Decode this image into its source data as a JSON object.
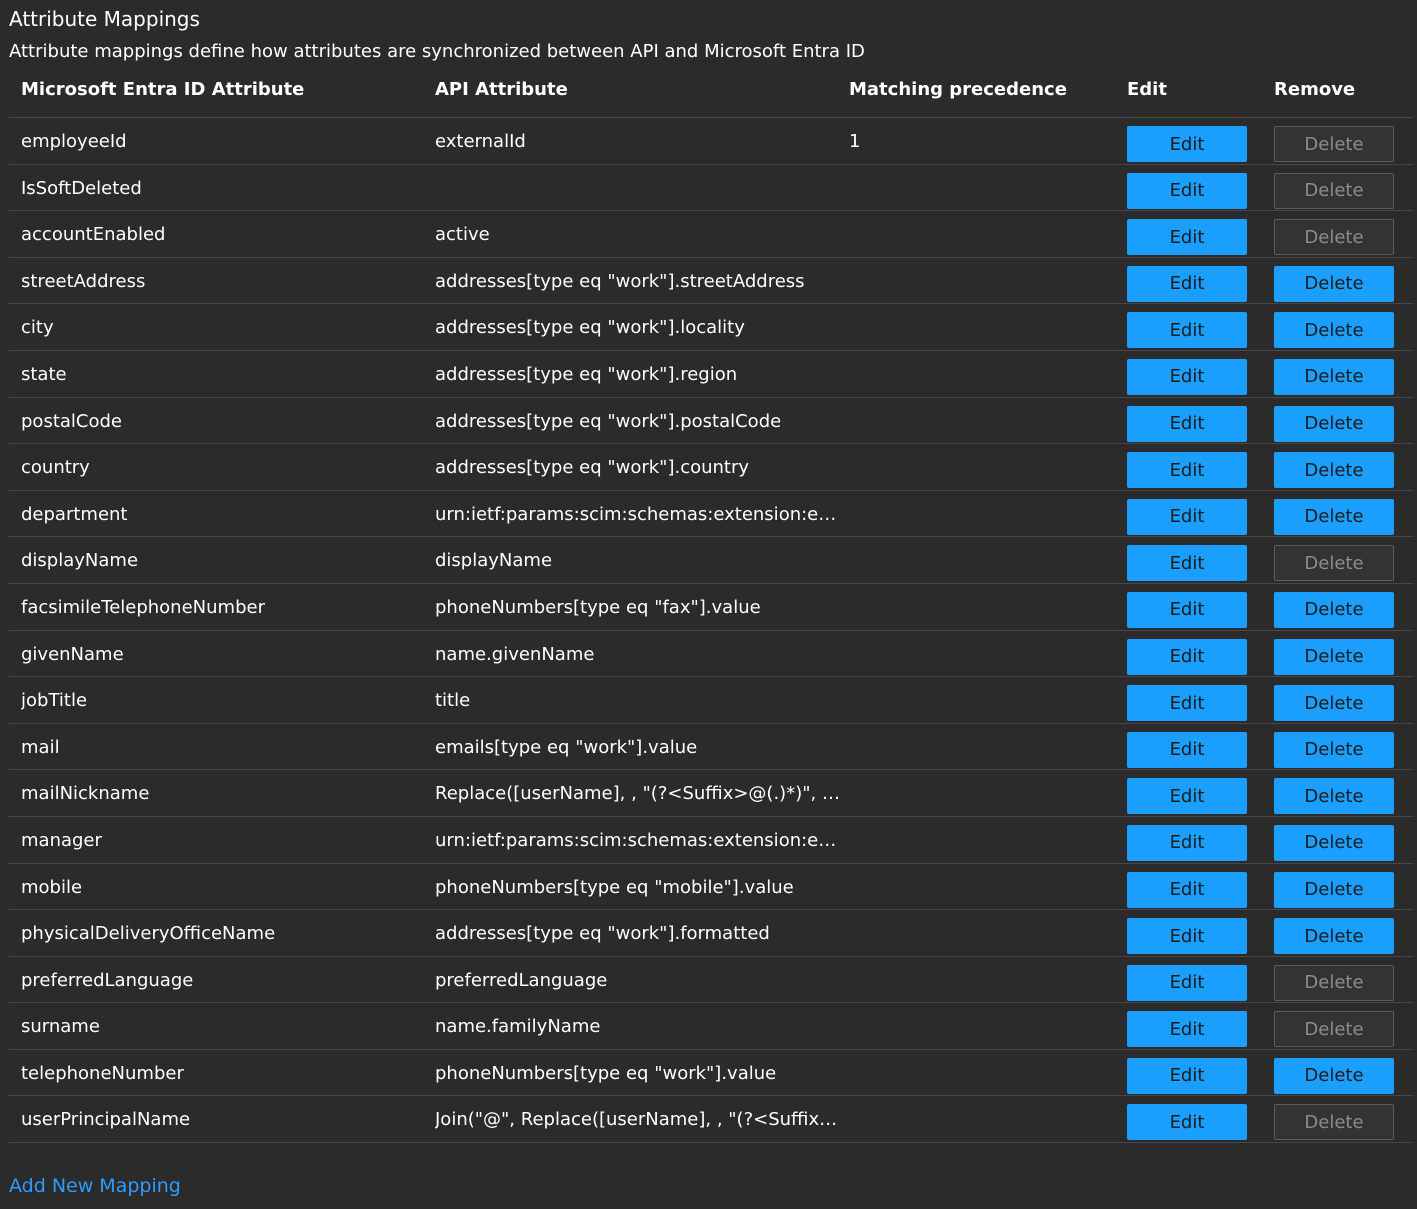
{
  "header": {
    "title": "Attribute Mappings",
    "subtitle": "Attribute mappings define how attributes are synchronized between API and Microsoft Entra ID"
  },
  "table": {
    "columns": [
      "Microsoft Entra ID Attribute",
      "API Attribute",
      "Matching precedence",
      "Edit",
      "Remove"
    ],
    "edit_label": "Edit",
    "delete_label": "Delete",
    "rows": [
      {
        "source": "employeeId",
        "target": "externalId",
        "precedence": "1",
        "delete_enabled": false
      },
      {
        "source": "IsSoftDeleted",
        "target": "",
        "precedence": "",
        "delete_enabled": false
      },
      {
        "source": "accountEnabled",
        "target": "active",
        "precedence": "",
        "delete_enabled": false
      },
      {
        "source": "streetAddress",
        "target": "addresses[type eq \"work\"].streetAddress",
        "precedence": "",
        "delete_enabled": true
      },
      {
        "source": "city",
        "target": "addresses[type eq \"work\"].locality",
        "precedence": "",
        "delete_enabled": true
      },
      {
        "source": "state",
        "target": "addresses[type eq \"work\"].region",
        "precedence": "",
        "delete_enabled": true
      },
      {
        "source": "postalCode",
        "target": "addresses[type eq \"work\"].postalCode",
        "precedence": "",
        "delete_enabled": true
      },
      {
        "source": "country",
        "target": "addresses[type eq \"work\"].country",
        "precedence": "",
        "delete_enabled": true
      },
      {
        "source": "department",
        "target": "urn:ietf:params:scim:schemas:extension:enter...",
        "precedence": "",
        "delete_enabled": true
      },
      {
        "source": "displayName",
        "target": "displayName",
        "precedence": "",
        "delete_enabled": false
      },
      {
        "source": "facsimileTelephoneNumber",
        "target": "phoneNumbers[type eq \"fax\"].value",
        "precedence": "",
        "delete_enabled": true
      },
      {
        "source": "givenName",
        "target": "name.givenName",
        "precedence": "",
        "delete_enabled": true
      },
      {
        "source": "jobTitle",
        "target": "title",
        "precedence": "",
        "delete_enabled": true
      },
      {
        "source": "mail",
        "target": "emails[type eq \"work\"].value",
        "precedence": "",
        "delete_enabled": true
      },
      {
        "source": "mailNickname",
        "target": "Replace([userName], , \"(?<Suffix>@(.)*)\", \"Su...",
        "precedence": "",
        "delete_enabled": true
      },
      {
        "source": "manager",
        "target": "urn:ietf:params:scim:schemas:extension:enter...",
        "precedence": "",
        "delete_enabled": true
      },
      {
        "source": "mobile",
        "target": "phoneNumbers[type eq \"mobile\"].value",
        "precedence": "",
        "delete_enabled": true
      },
      {
        "source": "physicalDeliveryOfficeName",
        "target": "addresses[type eq \"work\"].formatted",
        "precedence": "",
        "delete_enabled": true
      },
      {
        "source": "preferredLanguage",
        "target": "preferredLanguage",
        "precedence": "",
        "delete_enabled": false
      },
      {
        "source": "surname",
        "target": "name.familyName",
        "precedence": "",
        "delete_enabled": false
      },
      {
        "source": "telephoneNumber",
        "target": "phoneNumbers[type eq \"work\"].value",
        "precedence": "",
        "delete_enabled": true
      },
      {
        "source": "userPrincipalName",
        "target": "Join(\"@\", Replace([userName], , \"(?<Suffix>...",
        "precedence": "",
        "delete_enabled": false
      }
    ]
  },
  "footer": {
    "add_link": "Add New Mapping"
  },
  "colors": {
    "background": "#2b2b2b",
    "accent": "#1a9fff",
    "link": "#2f9bff"
  }
}
